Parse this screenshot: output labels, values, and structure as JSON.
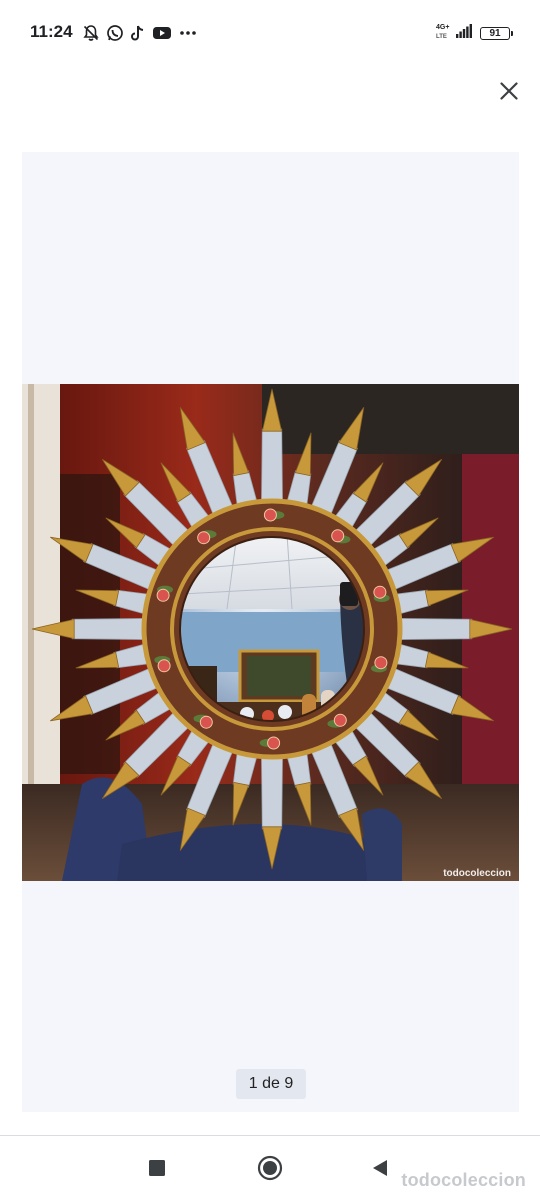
{
  "status_bar": {
    "time": "11:24",
    "network_top": "4G+",
    "network_bottom": "LTE",
    "battery": "91",
    "icons": [
      "mute-bell-icon",
      "whatsapp-icon",
      "tiktok-icon",
      "youtube-icon",
      "more-dots-icon",
      "signal-icon",
      "battery-icon"
    ]
  },
  "viewer": {
    "watermark": "todocoleccion",
    "counter": "1 de 9"
  },
  "footer": {
    "brand_mark": "todocoleccion"
  },
  "nav_bar": {
    "icons": [
      "recents-square-icon",
      "home-circle-icon",
      "back-triangle-icon"
    ]
  },
  "colors": {
    "background": "#ffffff",
    "viewer_bg": "#f5f6fb",
    "counter_bg": "#e3e7f0",
    "mirror_silver": "#c9d2dc",
    "mirror_gold": "#c8993a",
    "frame_wood": "#6e3a22",
    "wall_red": "#8a1e14"
  }
}
